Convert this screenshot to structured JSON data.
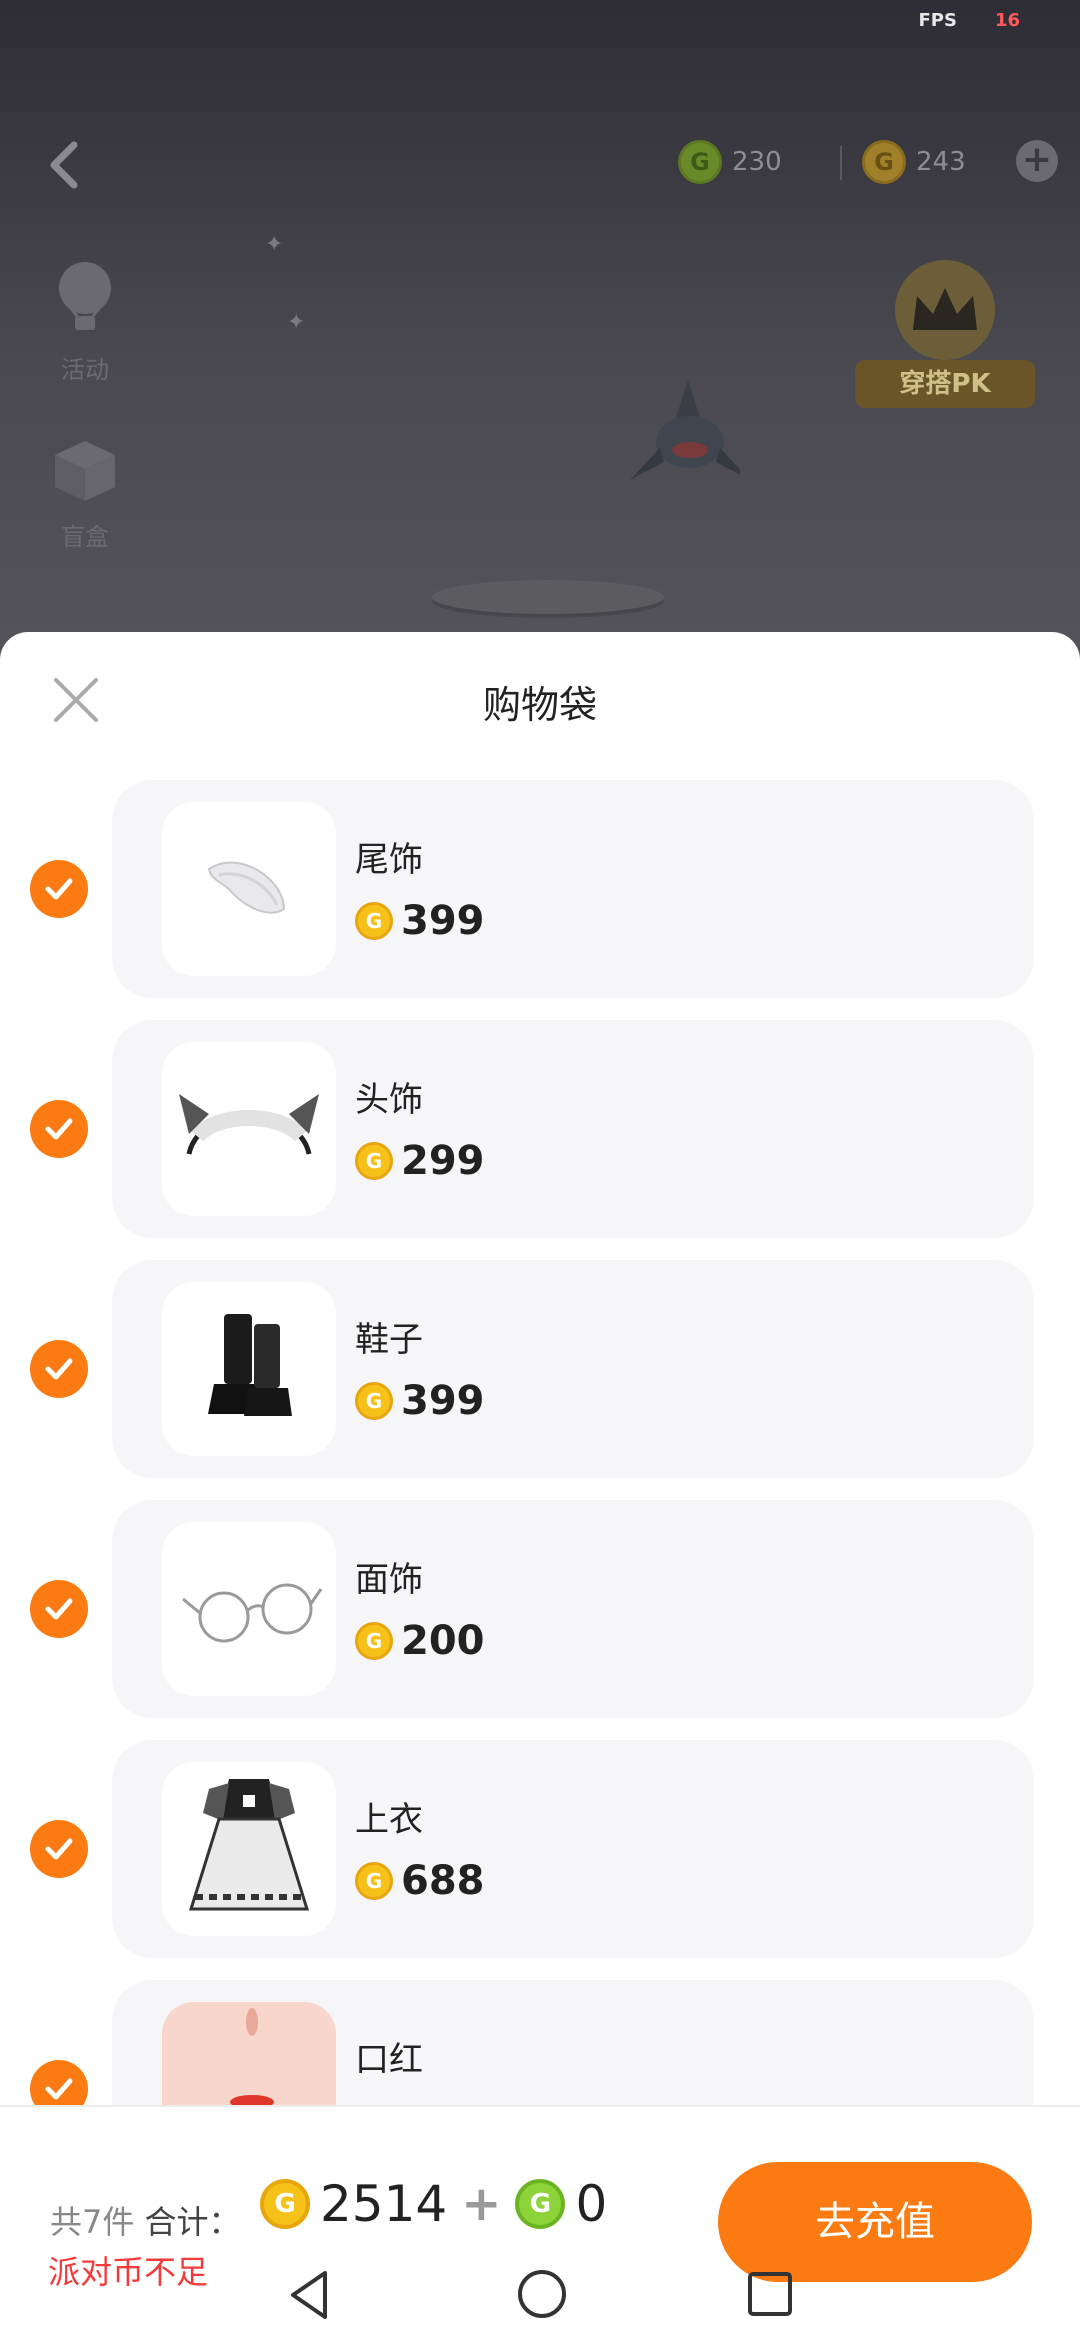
{
  "status": {
    "fps_label": "FPS",
    "fps_value": "16"
  },
  "topbar": {
    "green_coin_amount": "230",
    "gold_coin_amount": "243"
  },
  "side_menu": [
    {
      "label": "活动",
      "icon": "hot-air-balloon-icon"
    },
    {
      "label": "盲盒",
      "icon": "blind-box-icon"
    }
  ],
  "pk_badge": {
    "label": "穿搭PK"
  },
  "sheet": {
    "title": "购物袋",
    "items": [
      {
        "name": "尾饰",
        "price": "399",
        "checked": true,
        "thumb": "tail"
      },
      {
        "name": "头饰",
        "price": "299",
        "checked": true,
        "thumb": "headband"
      },
      {
        "name": "鞋子",
        "price": "399",
        "checked": true,
        "thumb": "shoes"
      },
      {
        "name": "面饰",
        "price": "200",
        "checked": true,
        "thumb": "glasses"
      },
      {
        "name": "上衣",
        "price": "688",
        "checked": true,
        "thumb": "dress"
      },
      {
        "name": "口红",
        "price": "",
        "checked": true,
        "thumb": "lipstick"
      }
    ]
  },
  "footer": {
    "count_label": "共7件",
    "total_label": "合计：",
    "gold_total": "2514",
    "plus": "+",
    "green_total": "0",
    "warning": "派对币不足",
    "cta_label": "去充值"
  },
  "colors": {
    "accent": "#fb7a12",
    "warning": "#f43a3a",
    "gold": "#f6c21a",
    "green": "#8cd43a"
  }
}
